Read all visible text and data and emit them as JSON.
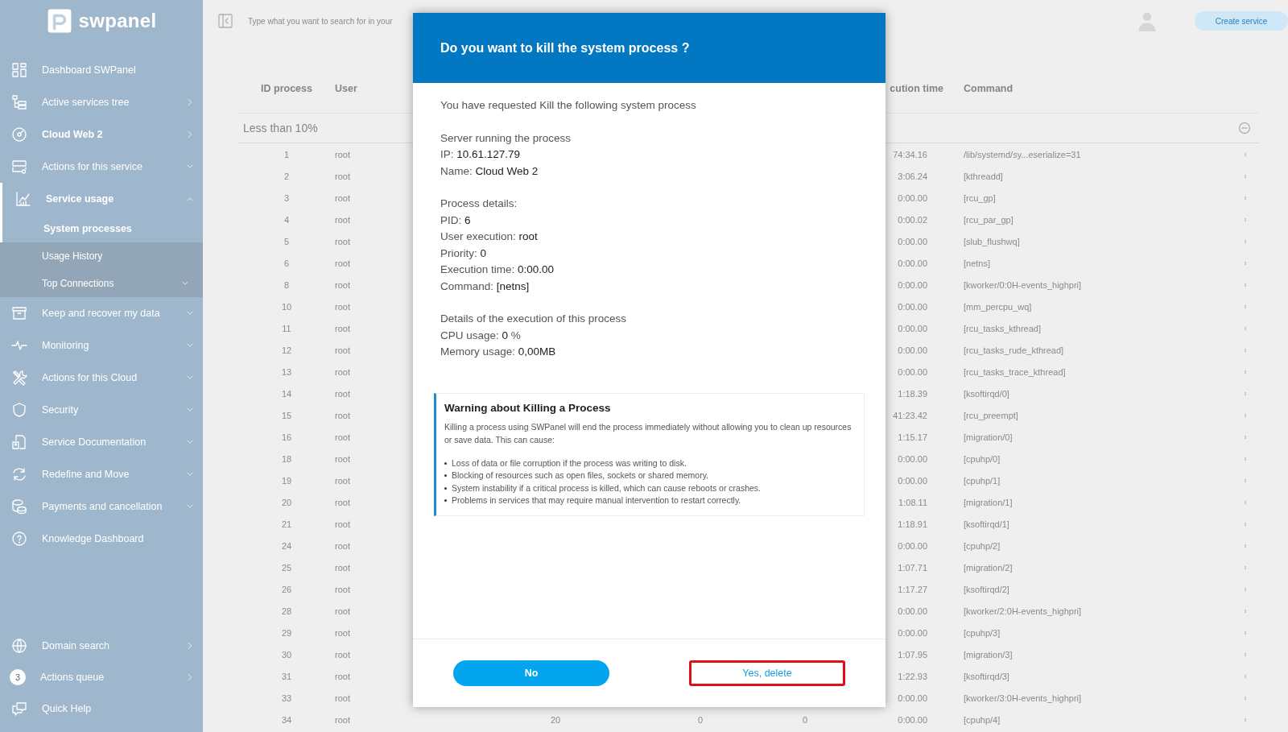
{
  "sidebar": {
    "logo": "swpanel",
    "items": [
      {
        "label": "Dashboard SWPanel",
        "kind": "plain",
        "bold": false
      },
      {
        "label": "Active services tree",
        "kind": "link",
        "bold": false
      },
      {
        "label": "Cloud Web 2",
        "kind": "link",
        "bold": true
      },
      {
        "label": "Actions for this service",
        "kind": "menu",
        "expanded": false,
        "bold": false
      },
      {
        "label": "Service usage",
        "kind": "menu",
        "bold": true,
        "expanded": true,
        "children": [
          {
            "label": "System processes",
            "selected": true,
            "kind": "plain"
          },
          {
            "label": "Usage History",
            "selected": false,
            "kind": "plain"
          },
          {
            "label": "Top Connections",
            "selected": false,
            "kind": "menu",
            "expanded": false
          }
        ]
      },
      {
        "label": "Keep and recover my data",
        "kind": "menu",
        "expanded": false,
        "bold": false
      },
      {
        "label": "Monitoring",
        "kind": "menu",
        "expanded": false,
        "bold": false
      },
      {
        "label": "Actions for this Cloud",
        "kind": "menu",
        "expanded": false,
        "bold": false
      },
      {
        "label": "Security",
        "kind": "menu",
        "expanded": false,
        "bold": false
      },
      {
        "label": "Service Documentation",
        "kind": "menu",
        "expanded": false,
        "bold": false
      },
      {
        "label": "Redefine and Move",
        "kind": "menu",
        "expanded": false,
        "bold": false
      },
      {
        "label": "Payments and cancellation",
        "kind": "menu",
        "expanded": false,
        "bold": false
      },
      {
        "label": "Knowledge Dashboard",
        "kind": "plain",
        "bold": false
      }
    ],
    "bottom_items": [
      {
        "label": "Domain search",
        "kind": "link"
      },
      {
        "label": "Actions queue",
        "kind": "link",
        "badge": "3"
      },
      {
        "label": "Quick Help",
        "kind": "plain"
      }
    ]
  },
  "topbar": {
    "search": {
      "placeholder": "Type what you want to search for in your"
    },
    "button": "Create service"
  },
  "table": {
    "columns": [
      "ID process",
      "User",
      "cution time",
      "Command"
    ],
    "group": "Less than 10%",
    "rows": [
      {
        "id": "1",
        "user": "root",
        "exec_time": "74:34.16",
        "command": "/lib/systemd/sy...eserialize=31"
      },
      {
        "id": "2",
        "user": "root",
        "exec_time": "3:06.24",
        "command": "[kthreadd]"
      },
      {
        "id": "3",
        "user": "root",
        "exec_time": "0:00.00",
        "command": "[rcu_gp]"
      },
      {
        "id": "4",
        "user": "root",
        "exec_time": "0:00.02",
        "command": "[rcu_par_gp]"
      },
      {
        "id": "5",
        "user": "root",
        "exec_time": "0:00.00",
        "command": "[slub_flushwq]"
      },
      {
        "id": "6",
        "user": "root",
        "exec_time": "0:00.00",
        "command": "[netns]"
      },
      {
        "id": "8",
        "user": "root",
        "exec_time": "0:00.00",
        "command": "[kworker/0:0H-events_highpri]"
      },
      {
        "id": "10",
        "user": "root",
        "exec_time": "0:00.00",
        "command": "[mm_percpu_wq]"
      },
      {
        "id": "11",
        "user": "root",
        "exec_time": "0:00.00",
        "command": "[rcu_tasks_kthread]"
      },
      {
        "id": "12",
        "user": "root",
        "exec_time": "0:00.00",
        "command": "[rcu_tasks_rude_kthread]"
      },
      {
        "id": "13",
        "user": "root",
        "exec_time": "0:00.00",
        "command": "[rcu_tasks_trace_kthread]"
      },
      {
        "id": "14",
        "user": "root",
        "exec_time": "1:18.39",
        "command": "[ksoftirqd/0]"
      },
      {
        "id": "15",
        "user": "root",
        "exec_time": "41:23.42",
        "command": "[rcu_preempt]"
      },
      {
        "id": "16",
        "user": "root",
        "exec_time": "1:15.17",
        "command": "[migration/0]"
      },
      {
        "id": "18",
        "user": "root",
        "exec_time": "0:00.00",
        "command": "[cpuhp/0]"
      },
      {
        "id": "19",
        "user": "root",
        "exec_time": "0:00.00",
        "command": "[cpuhp/1]"
      },
      {
        "id": "20",
        "user": "root",
        "exec_time": "1:08.11",
        "command": "[migration/1]"
      },
      {
        "id": "21",
        "user": "root",
        "exec_time": "1:18.91",
        "command": "[ksoftirqd/1]"
      },
      {
        "id": "24",
        "user": "root",
        "exec_time": "0:00.00",
        "command": "[cpuhp/2]"
      },
      {
        "id": "25",
        "user": "root",
        "exec_time": "1:07.71",
        "command": "[migration/2]"
      },
      {
        "id": "26",
        "user": "root",
        "exec_time": "1:17.27",
        "command": "[ksoftirqd/2]"
      },
      {
        "id": "28",
        "user": "root",
        "exec_time": "0:00.00",
        "command": "[kworker/2:0H-events_highpri]"
      },
      {
        "id": "29",
        "user": "root",
        "exec_time": "0:00.00",
        "command": "[cpuhp/3]"
      },
      {
        "id": "30",
        "user": "root",
        "exec_time": "1:07.95",
        "command": "[migration/3]"
      },
      {
        "id": "31",
        "user": "root",
        "exec_time": "1:22.93",
        "command": "[ksoftirqd/3]"
      },
      {
        "id": "33",
        "user": "root",
        "exec_time": "0:00.00",
        "command": "[kworker/3:0H-events_highpri]"
      },
      {
        "id": "34",
        "user": "root",
        "column_3": "20",
        "column_4": "0",
        "column_5": "0",
        "exec_time": "0:00.00",
        "command": "[cpuhp/4]"
      }
    ]
  },
  "modal": {
    "title": "Do you want to kill the system process ?",
    "paragraphs": [
      [
        "You have requested Kill the following system process"
      ],
      [
        "Server running the process",
        "IP: **10.61.127.79**",
        "Name: **Cloud Web 2**"
      ],
      [
        "Process details:",
        "PID: **6**",
        "User execution: **root**",
        "Priority: **0**",
        "Execution time: **0:00.00**",
        "Command: **[netns]**"
      ],
      [
        "Details of the execution of this process",
        "CPU usage: **0** %",
        "Memory usage: **0,00MB**"
      ]
    ],
    "warning": {
      "title": "Warning about Killing a Process",
      "text": "Killing a process using SWPanel will end the process immediately without allowing you to clean up resources or save data. This can cause:",
      "bullets": [
        "Loss of data or file corruption if the process was writing to disk.",
        "Blocking of resources such as open files, sockets or shared memory.",
        "System instability if a critical process is killed, which can cause reboots or crashes.",
        "Problems in services that may require manual intervention to restart correctly."
      ]
    },
    "buttons": [
      {
        "label": "No",
        "kind": "primary",
        "highlighted": false
      },
      {
        "label": "Yes, delete",
        "kind": "secondary",
        "highlighted": true
      }
    ]
  }
}
